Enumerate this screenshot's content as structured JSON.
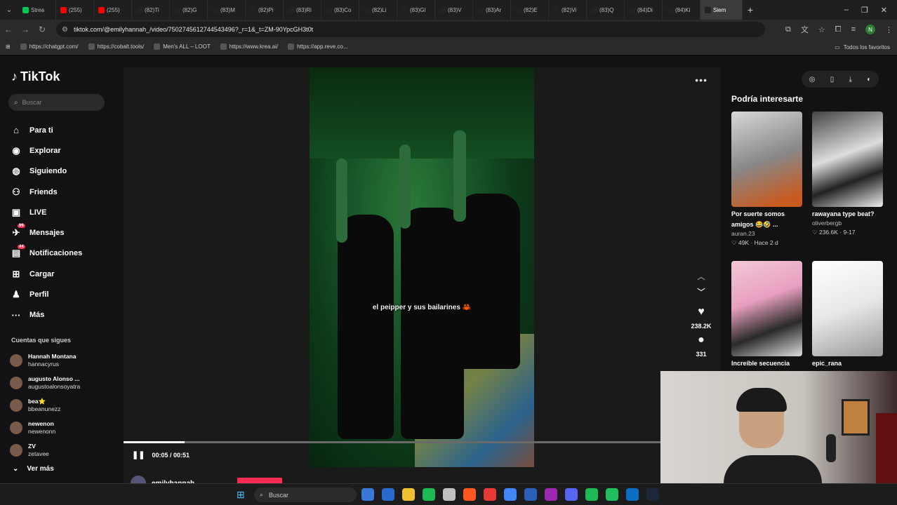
{
  "browser": {
    "tabs": [
      {
        "label": "Strea",
        "color": "#00c853"
      },
      {
        "label": "(255)",
        "color": "#ff0000"
      },
      {
        "label": "(255)",
        "color": "#ff0000"
      },
      {
        "label": "(82)Ti",
        "color": "#222222"
      },
      {
        "label": "(82)G",
        "color": "#222222"
      },
      {
        "label": "(83)M",
        "color": "#222222"
      },
      {
        "label": "(82)Pi",
        "color": "#222222"
      },
      {
        "label": "(83)Ri",
        "color": "#222222"
      },
      {
        "label": "(83)Co",
        "color": "#222222"
      },
      {
        "label": "(82)Li",
        "color": "#222222"
      },
      {
        "label": "(83)Gl",
        "color": "#222222"
      },
      {
        "label": "(83)V",
        "color": "#222222"
      },
      {
        "label": "(83)Ar",
        "color": "#222222"
      },
      {
        "label": "(82)E",
        "color": "#222222"
      },
      {
        "label": "(82)Vi",
        "color": "#222222"
      },
      {
        "label": "(83)Q",
        "color": "#222222"
      },
      {
        "label": "(84)Di",
        "color": "#222222"
      },
      {
        "label": "(84)Ki",
        "color": "#222222"
      },
      {
        "label": "Siem",
        "color": "#222222"
      }
    ],
    "url": "tiktok.com/@emilyhannah_/video/7502745612744543496?_r=1&_t=ZM-90YpcGH3t0t",
    "bookmarks": [
      "https://chatgpt.com/",
      "https://cobalt.tools/",
      "Men's ALL – LOOT",
      "https://www.krea.ai/",
      "https://app.reve.co..."
    ],
    "bookmarks_right": "Todos los favoritos",
    "profile_initial": "N"
  },
  "tiktok": {
    "logo": "TikTok",
    "search_placeholder": "Buscar",
    "nav": [
      {
        "label": "Para ti",
        "icon": "home-icon",
        "glyph": "⌂"
      },
      {
        "label": "Explorar",
        "icon": "compass-icon",
        "glyph": "◉"
      },
      {
        "label": "Siguiendo",
        "icon": "following-icon",
        "glyph": "◍"
      },
      {
        "label": "Friends",
        "icon": "friends-icon",
        "glyph": "⚇"
      },
      {
        "label": "LIVE",
        "icon": "live-icon",
        "glyph": "▣"
      },
      {
        "label": "Mensajes",
        "icon": "messages-icon",
        "glyph": "✈",
        "badge": "99"
      },
      {
        "label": "Notificaciones",
        "icon": "notifications-icon",
        "glyph": "▤",
        "badge": "44"
      },
      {
        "label": "Cargar",
        "icon": "upload-icon",
        "glyph": "⊞"
      },
      {
        "label": "Perfil",
        "icon": "profile-icon",
        "glyph": "♟"
      },
      {
        "label": "Más",
        "icon": "more-icon",
        "glyph": "···"
      }
    ],
    "following_title": "Cuentas que sigues",
    "following": [
      {
        "name": "Hannah Montana",
        "handle": "hannacyrus"
      },
      {
        "name": "augusto Alonso ...",
        "handle": "augustoalonsoyatra"
      },
      {
        "name": "bea⭐",
        "handle": "bbeanunezz"
      },
      {
        "name": "newenon",
        "handle": "newenonn"
      },
      {
        "name": "ZV",
        "handle": "zetavee"
      }
    ],
    "see_more": "Ver más",
    "video": {
      "caption": "el peipper y sus bailarines 🦀",
      "likes": "238.2K",
      "comments": "331",
      "time": "00:05 / 00:51",
      "progress": 0.114,
      "author": "emilyhannah"
    },
    "recommended_title": "Podría interesarte",
    "recommended": [
      {
        "title": "Por suerte somos amigos 😂🤣 ...",
        "author": "auran.23",
        "stats": "♡ 49K · Hace 2 d",
        "thumb": "linear-gradient(160deg,#d8d8d8,#888 50%,#c85a20 90%)"
      },
      {
        "title": "rawayana type beat?",
        "author": "oliverbergb",
        "stats": "♡ 236.6K · 9-17",
        "thumb": "linear-gradient(160deg,#444,#ddd 45%,#222 70%,#eee)"
      },
      {
        "title": "Increíble secuencia",
        "author": "",
        "stats": "",
        "thumb": "linear-gradient(160deg,#f2c8d8,#e8a0c0 40%,#2a2a2a 70%,#ddd)"
      },
      {
        "title": "epic_rana",
        "author": "",
        "stats": "",
        "thumb": "linear-gradient(160deg,#ffffff,#e8e8e8 50%,#999 100%)"
      }
    ]
  },
  "taskbar": {
    "search_placeholder": "Buscar",
    "apps": [
      "#3a78d8",
      "#2a6ad0",
      "#f0c030",
      "#1db954",
      "#c0c0c0",
      "#ff5722",
      "#e53935",
      "#4285f4",
      "#2b5fb8",
      "#9c27b0",
      "#5865f2",
      "#1db954",
      "#20c060",
      "#0a6fc4",
      "#1b2838"
    ]
  }
}
